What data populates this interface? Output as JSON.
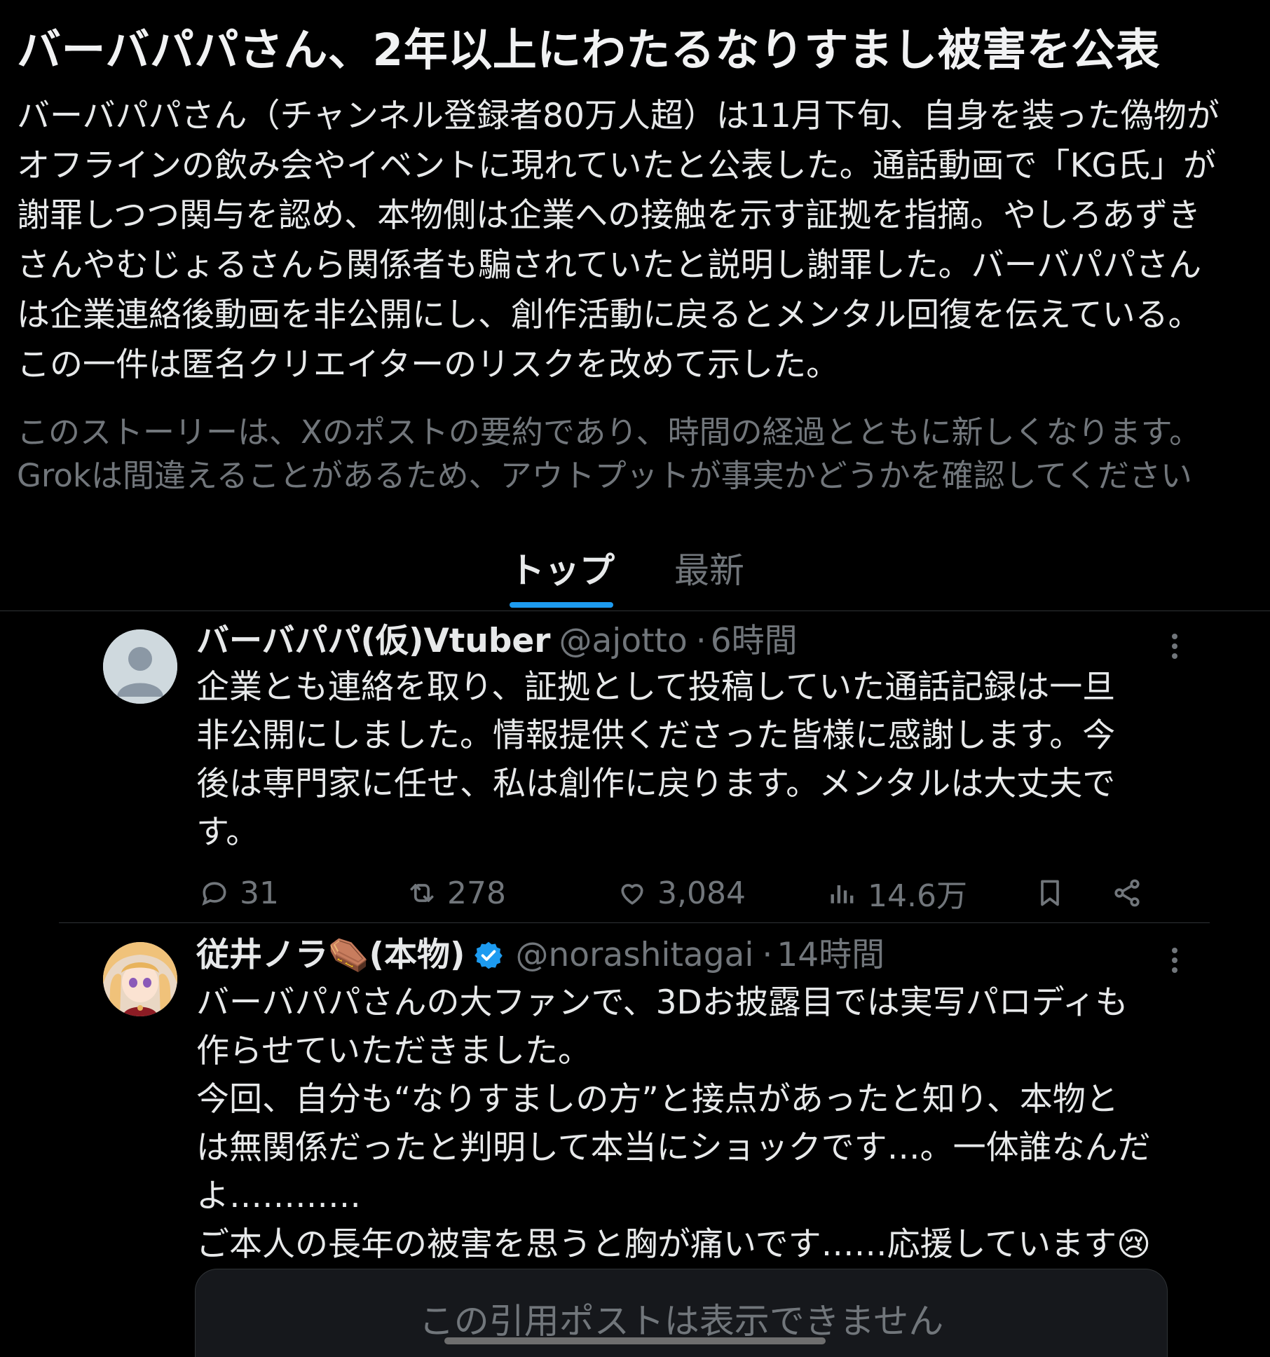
{
  "story": {
    "title": "バーバパパさん、2年以上にわたるなりすまし被害を公表",
    "summary_lines": [
      "バーバパパさん（チャンネル登録者80万人超）は11月下旬、自身を装った偽物が",
      "オフラインの飲み会やイベントに現れていたと公表した。通話動画で「KG氏」が",
      "謝罪しつつ関与を認め、本物側は企業への接触を示す証拠を指摘。やしろあずき",
      "さんやむじょるさんら関係者も騙されていたと説明し謝罪した。バーバパパさん",
      "は企業連絡後動画を非公開にし、創作活動に戻るとメンタル回復を伝えている。",
      "この一件は匿名クリエイターのリスクを改めて示した。"
    ],
    "disclaimer_lines": [
      "このストーリーは、Xのポストの要約であり、時間の経過とともに新しくなります。",
      "Grokは間違えることがあるため、アウトプットが事実かどうかを確認してください"
    ]
  },
  "tabs": [
    {
      "label": "トップ",
      "active": true
    },
    {
      "label": "最新",
      "active": false
    }
  ],
  "posts": [
    {
      "display_name": "バーバパパ(仮)Vtuber",
      "handle": "@ajotto",
      "time": "6時間",
      "verified": false,
      "avatar_icon": "default-avatar-icon",
      "text_lines": [
        "企業とも連絡を取り、証拠として投稿していた通話記録は一旦",
        "非公開にしました。情報提供くださった皆様に感謝します。今",
        "後は専門家に任せ、私は創作に戻ります。メンタルは大丈夫で",
        "す。"
      ],
      "stats": {
        "replies": "31",
        "reposts": "278",
        "likes": "3,084",
        "views": "14.6万"
      }
    },
    {
      "display_name": "従井ノラ⚰️(本物)",
      "handle": "@norashitagai",
      "time": "14時間",
      "verified": true,
      "avatar_icon": "anime-character-avatar",
      "text_lines": [
        "バーバパパさんの大ファンで、3Dお披露目では実写パロディも",
        "作らせていただきました。",
        "今回、自分も“なりすましの方”と接点があったと知り、本物と",
        "は無関係だったと判明して本当にショックです…。一体誰なんだ",
        "よ…………",
        "ご本人の長年の被害を思うと胸が痛いです……応援しています😢"
      ],
      "quote_notice": "この引用ポストは表示できません"
    }
  ],
  "colors": {
    "background": "#000000",
    "text": "#e7e9ea",
    "muted": "#71767b",
    "accent": "#1d9bf0",
    "divider": "#2f3336"
  }
}
